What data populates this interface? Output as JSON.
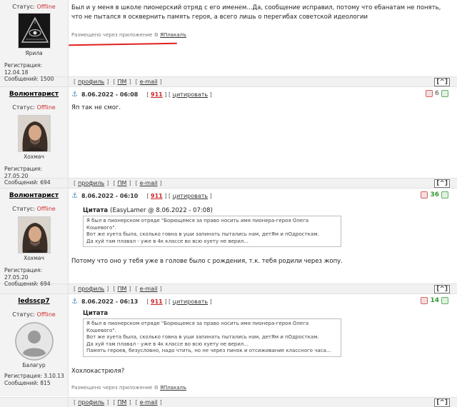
{
  "posts": [
    {
      "author": "",
      "status_label": "Статус:",
      "status_value": "Offline",
      "rank": "Ярила",
      "reg_date": "Регистрация: 12.04.18",
      "messages": "Сообщений: 1500",
      "body": "Был и у меня в школе пионерский отряд с его именем...Да, сообщение исправил, потому что ебанатам не понять, что не пытался я осквернить память героя, а всего лишь о перегибах советской идеологии",
      "via_prefix": "Размещено через приложение",
      "via_app": "ЯПлакалъ"
    },
    {
      "author": "Волюнтарист",
      "status_label": "Статус:",
      "status_value": "Offline",
      "rank": "Хохмач",
      "reg_date": "Регистрация: 27.05.20",
      "messages": "Сообщений: 694",
      "date": "8.06.2022 - 06:08",
      "post_num": "911",
      "cite_label": "цитировать",
      "votes": "6",
      "body": "Яп так не смог."
    },
    {
      "author": "Волюнтарист",
      "status_label": "Статус:",
      "status_value": "Offline",
      "rank": "Хохмач",
      "reg_date": "Регистрация: 27.05.20",
      "messages": "Сообщений: 694",
      "date": "8.06.2022 - 06:10",
      "post_num": "911",
      "cite_label": "цитировать",
      "votes": "36",
      "quote_title": "Цитата",
      "quote_source": "(EasyLamer @ 8.06.2022 - 07:08)",
      "quote_lines": [
        "Я был в пионерском отряде \"Борющемся за право носить имя пионера-героя Олега Кошевого\".",
        "Вот же хуета была, сколько говна в уши запинать пытались нам, детЯм и пОдросткам.",
        "Да хуй там плавал - уже в 4к классе во всю хуету не верил..."
      ],
      "body": "Потому что оно у тебя уже в голове было с рождения, т.к. тебя родили через жопу."
    },
    {
      "author": "ledsscp7",
      "status_label": "Статус:",
      "status_value": "Offline",
      "rank": "Балагур",
      "reg_date": "Регистрация: 3.10.13",
      "messages": "Сообщений: 815",
      "date": "8.06.2022 - 06:13",
      "post_num": "911",
      "cite_label": "цитировать",
      "votes": "14",
      "quote_title": "Цитата",
      "quote_lines": [
        "Я был в пионерском отряде \"Борющемся за право носить имя пионера-героя Олега Кошевого\".",
        "Вот же хуета была, сколько говна в уши запинать пытались нам, детЯм и пОдросткам.",
        "Да хуй там плавал - уже в 4к классе во всю хуету не верил...",
        "Память героев, безусловно, надо чтить, но не через пинок и отсиживание классного часа..."
      ],
      "body": "Хохлокастрюля?",
      "via_prefix": "Размещено через приложение",
      "via_app": "ЯПлакалъ"
    }
  ],
  "footer": {
    "profile": "профиль",
    "pm": "ПМ",
    "email": "e-mail",
    "top": "[^]"
  },
  "colors": {
    "offline": "#cc3333",
    "vote_positive": "#339933",
    "post_num": "#cc2222",
    "annotation": "#e02020"
  }
}
